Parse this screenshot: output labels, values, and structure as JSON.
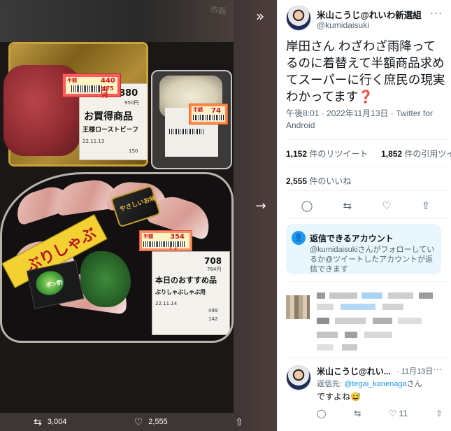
{
  "viewer": {
    "expand_icon": "chevrons-right-icon",
    "next_icon": "arrow-right-icon",
    "retweet_count": "3,004",
    "like_count": "2,555",
    "photo": {
      "beef_label_title": "お買得商品",
      "beef_label_product": "王様ローストビーフ",
      "beef_label_date": "22.11.13",
      "beef_price": "880",
      "beef_price_sub": "950円",
      "beef_sticker_top": "440円",
      "beef_sticker_sub": "475円",
      "beef_sticker_tag": "半額",
      "beef_weight": "150",
      "salad_sticker_tag": "半額",
      "salad_sticker_price": "74",
      "sashimi_band": "ぶりしゃぶ",
      "sashimi_badge": "やさしいお味",
      "sashimi_label_title": "本日のおすすめ品",
      "sashimi_label_product": "ぶりしゃぶしゃぶ用",
      "sashimi_label_date": "22.11.14",
      "sashimi_price": "708",
      "sashimi_price_sub": "764円",
      "sashimi_sticker_top": "354円",
      "sashimi_sticker_tag": "半額",
      "sashimi_weight_1": "499",
      "sashimi_weight_2": "142",
      "sauce_text": "ポン酢"
    }
  },
  "tweet": {
    "author_name": "米山こうじ@れいわ新選組...",
    "author_handle": "@kumidaisuki",
    "text": "岸田さん わざわざ雨降ってるのに着替えて半額商品求めてスーパーに行く庶民の現実わかってます❓",
    "time": "午後8:01 · 2022年11月13日 · ",
    "source": "Twitter for Android",
    "retweets_count": "1,152",
    "retweets_label": " 件のリツイート",
    "quotes_count": "1,852",
    "quotes_label": " 件の引用ツイート",
    "likes_count": "2,555",
    "likes_label": " 件のいいね"
  },
  "reply_notice": {
    "title": "返信できるアカウント",
    "body": "@kumidaisukiさんがフォローしているか@ツイートしたアカウントが返信できます"
  },
  "reply2": {
    "name": "米山こうじ@れい...",
    "date": "· 11月13日",
    "to_prefix": "返信先: ",
    "to_mention": "@tegai_kanenaga",
    "to_suffix": "さん",
    "text": "ですよね😅",
    "like_count": "11"
  },
  "colors": {
    "accent": "#1d9bf0",
    "text": "#0f1419",
    "muted": "#536471",
    "viewer_bg": "#3e3535"
  }
}
